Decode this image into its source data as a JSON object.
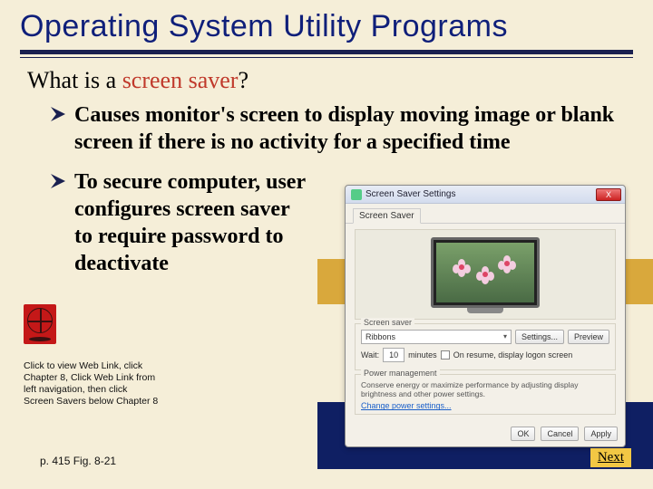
{
  "title": "Operating System Utility Programs",
  "question": {
    "prefix": "What is a ",
    "term": "screen saver",
    "suffix": "?"
  },
  "bullets": [
    "Causes monitor's screen to display moving image or blank screen if there is no activity for a specified time",
    "To secure computer, user configures screen saver to require password to deactivate"
  ],
  "dialog": {
    "title": "Screen Saver Settings",
    "close_label": "X",
    "tab_label": "Screen Saver",
    "group_label": "Screen saver",
    "combo_value": "Ribbons",
    "settings_btn": "Settings...",
    "preview_btn": "Preview",
    "wait_label": "Wait:",
    "wait_value": "10",
    "minutes_label": "minutes",
    "resume_label": "On resume, display logon screen",
    "pm_label": "Power management",
    "pm_desc": "Conserve energy or maximize performance by adjusting display brightness and other power settings.",
    "pm_link": "Change power settings...",
    "ok_btn": "OK",
    "cancel_btn": "Cancel",
    "apply_btn": "Apply"
  },
  "weblink_instruction": "Click to view Web Link, click Chapter 8, Click Web Link from left navigation, then click Screen Savers below Chapter 8",
  "page_ref": "p. 415 Fig. 8-21",
  "next_label": "Next"
}
